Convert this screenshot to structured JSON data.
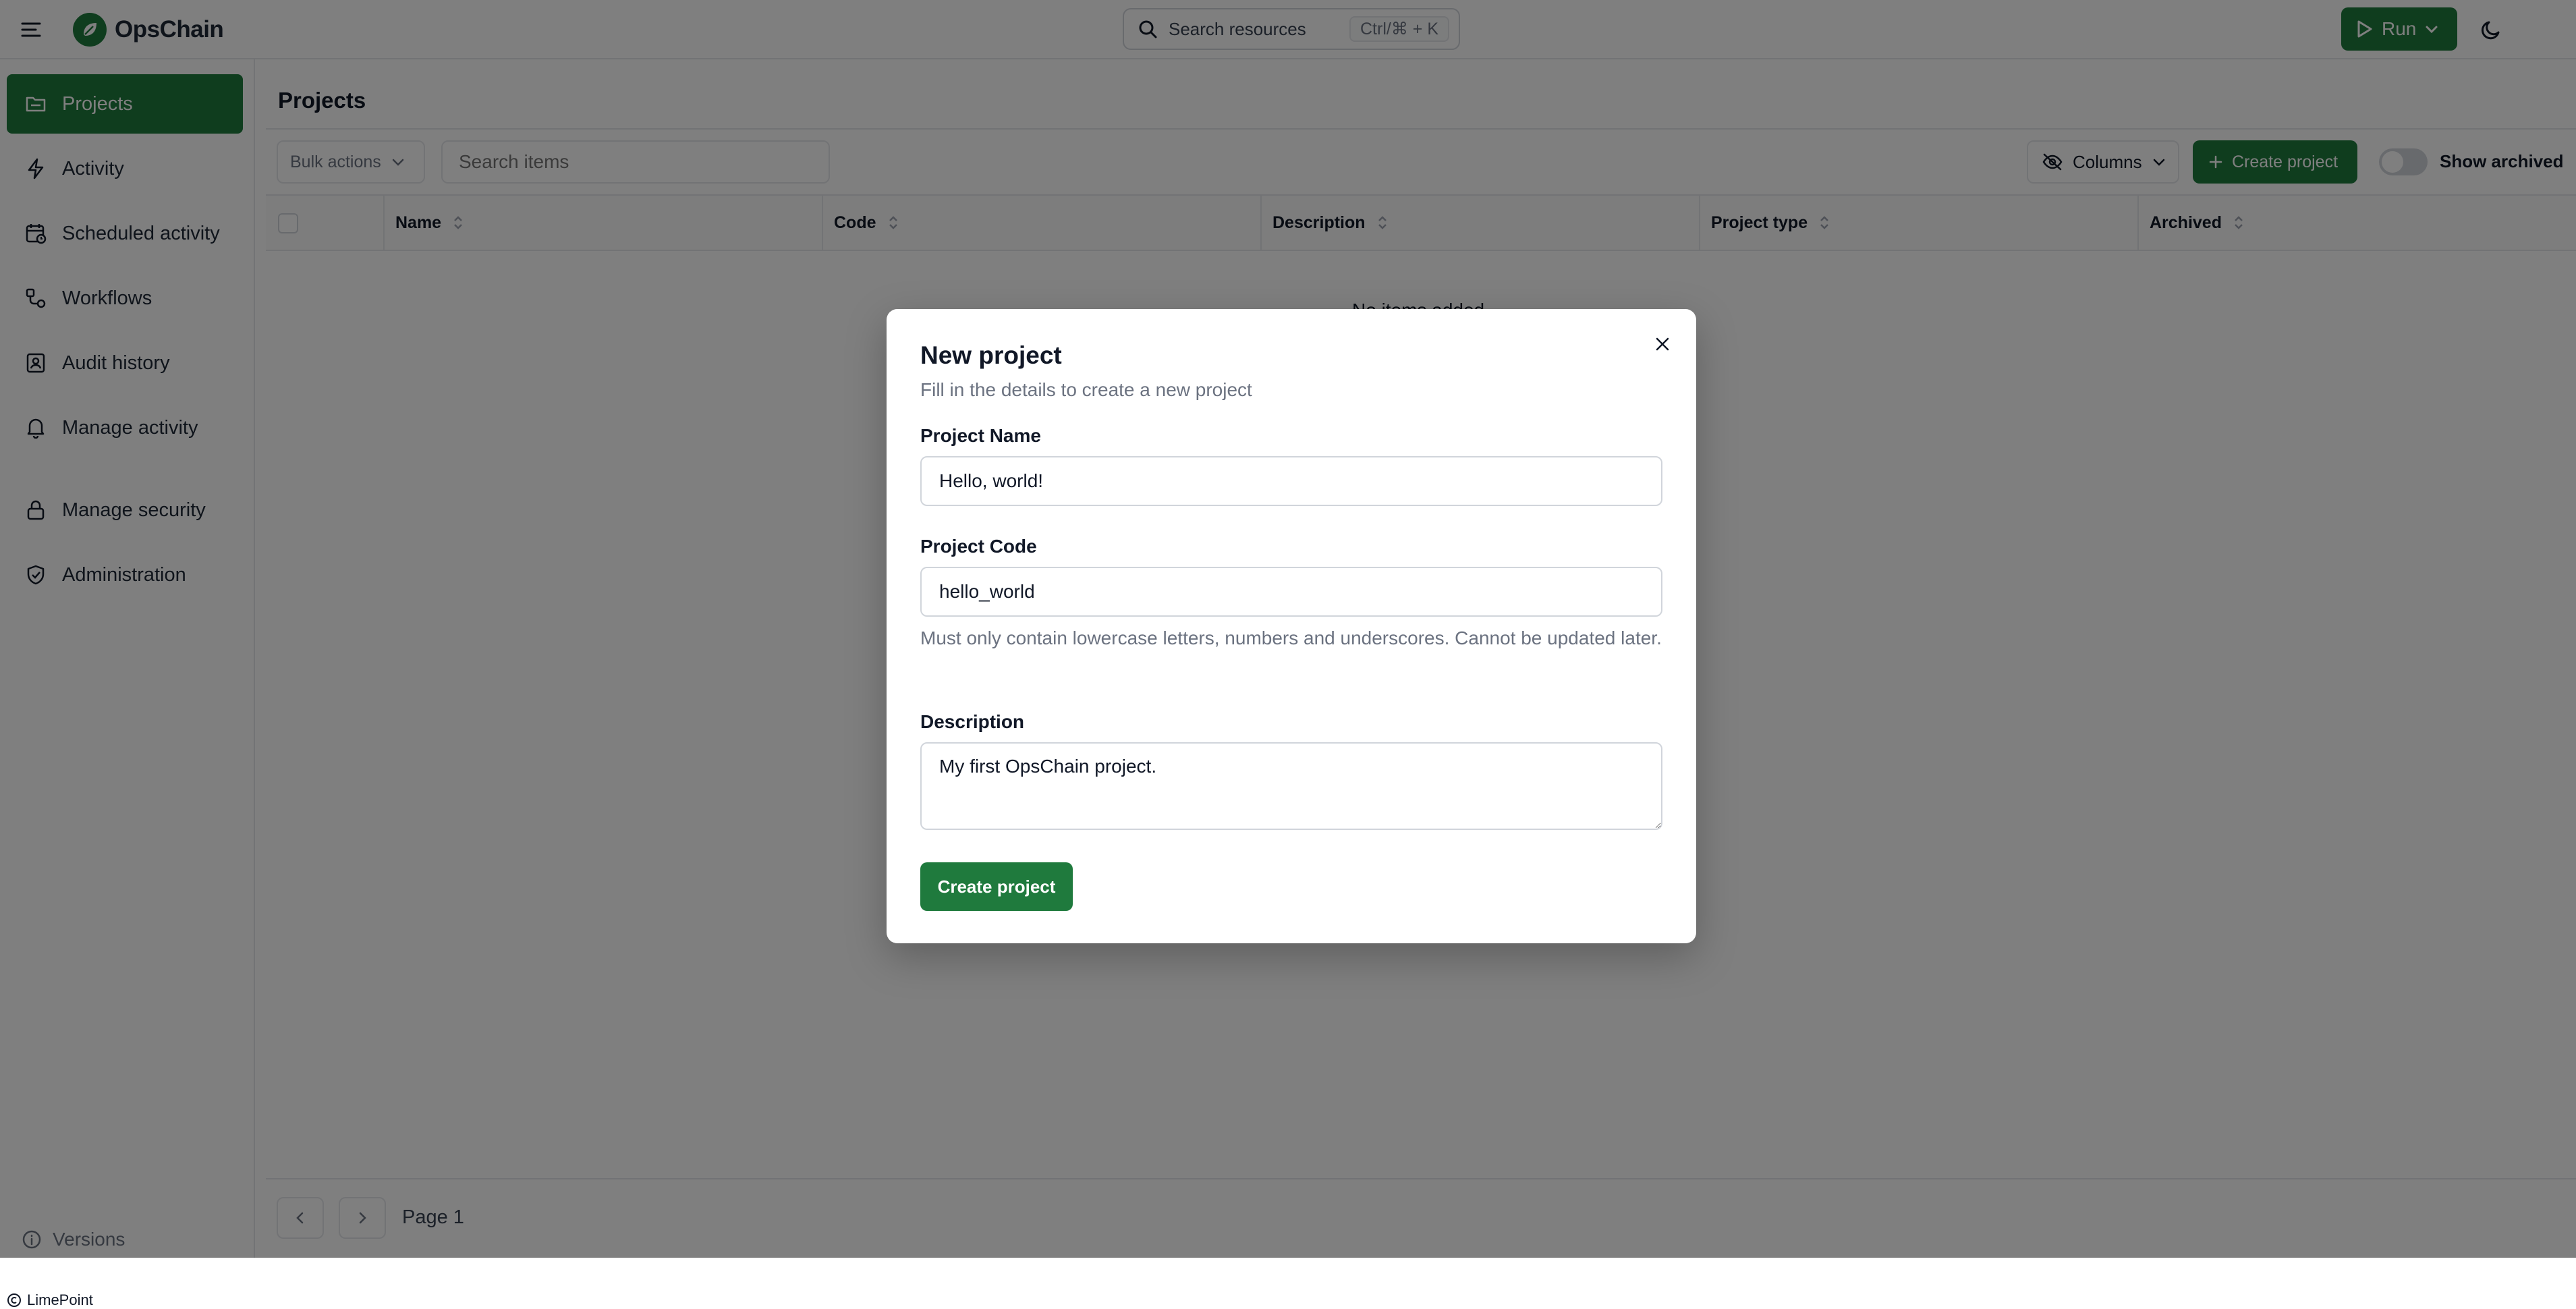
{
  "app": {
    "name": "OpsChain",
    "search_label": "Search resources",
    "search_shortcut": "Ctrl/⌘ + K",
    "run_label": "Run"
  },
  "sidebar": {
    "items": [
      {
        "label": "Projects",
        "icon": "folder-icon",
        "active": true
      },
      {
        "label": "Activity",
        "icon": "lightning-icon"
      },
      {
        "label": "Scheduled activity",
        "icon": "calendar-clock-icon"
      },
      {
        "label": "Workflows",
        "icon": "workflow-icon"
      },
      {
        "label": "Audit history",
        "icon": "audit-icon"
      },
      {
        "label": "Manage activity",
        "icon": "bell-icon"
      },
      {
        "label": "Manage security",
        "icon": "lock-icon"
      },
      {
        "label": "Administration",
        "icon": "shield-check-icon"
      }
    ],
    "versions_label": "Versions",
    "footer_brand": "LimePoint"
  },
  "main": {
    "title": "Projects",
    "bulk_actions_label": "Bulk actions",
    "search_placeholder": "Search items",
    "columns_label": "Columns",
    "create_label": "Create project",
    "show_archived_label": "Show archived",
    "columns": [
      "Name",
      "Code",
      "Description",
      "Project type",
      "Archived"
    ],
    "empty_text": "No items added",
    "page_label": "Page 1"
  },
  "dialog": {
    "title": "New project",
    "subtitle": "Fill in the details to create a new project",
    "name_label": "Project Name",
    "name_value": "Hello, world!",
    "code_label": "Project Code",
    "code_value": "hello_world",
    "code_help": "Must only contain lowercase letters, numbers and underscores. Cannot be updated later.",
    "description_label": "Description",
    "description_value": "My first OpsChain project.",
    "submit_label": "Create project"
  },
  "colors": {
    "primary": "#1f7a3d",
    "border": "#e5e7eb",
    "muted_text": "#6b7280"
  }
}
